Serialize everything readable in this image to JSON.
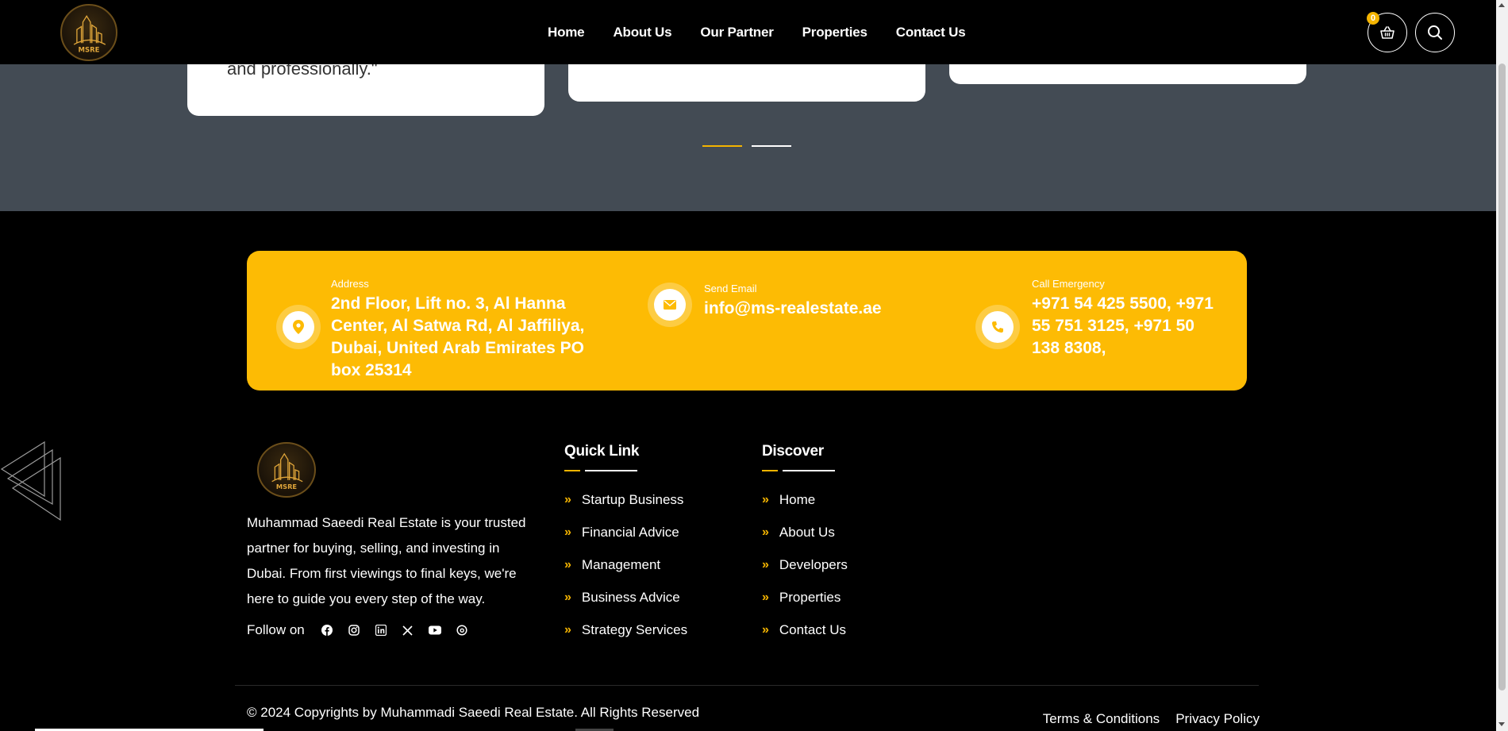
{
  "header": {
    "logo_text": "MSRE",
    "nav": [
      "Home",
      "About Us",
      "Our Partner",
      "Properties",
      "Contact Us"
    ],
    "cart_count": "0"
  },
  "testimonials": {
    "quote_fragment": "and professionally.\"",
    "slides": 2,
    "active_slide": 1
  },
  "contact": {
    "address": {
      "label": "Address",
      "value": "2nd Floor, Lift no. 3, Al Hanna Center, Al Satwa Rd, Al Jaffiliya, Dubai, United Arab Emirates PO box 25314"
    },
    "email": {
      "label": "Send Email",
      "value": "info@ms-realestate.ae"
    },
    "phone": {
      "label": "Call Emergency",
      "value": "+971 54 425 5500, +971 55 751 3125, +971 50 138 8308,"
    }
  },
  "footer": {
    "logo_text": "MSRE",
    "about": "Muhammad Saeedi Real Estate is your trusted partner for buying, selling, and investing in Dubai. From first viewings to final keys, we're here to guide you every step of the way.",
    "follow_label": "Follow on",
    "social_icons": [
      "facebook-icon",
      "instagram-icon",
      "linkedin-icon",
      "x-icon",
      "youtube-icon",
      "threads-icon"
    ],
    "quick_link": {
      "title": "Quick Link",
      "items": [
        "Startup Business",
        "Financial Advice",
        "Management",
        "Business Advice",
        "Strategy Services"
      ]
    },
    "discover": {
      "title": "Discover",
      "items": [
        "Home",
        "About Us",
        "Developers",
        "Properties",
        "Contact Us"
      ]
    },
    "copyright": "© 2024 Copyrights by Muhammadi Saeedi Real Estate. All Rights Reserved",
    "legal": [
      "Terms & Conditions",
      "Privacy Policy"
    ]
  },
  "colors": {
    "accent": "#fdbb04",
    "band": "#434b54",
    "background": "#000000"
  }
}
